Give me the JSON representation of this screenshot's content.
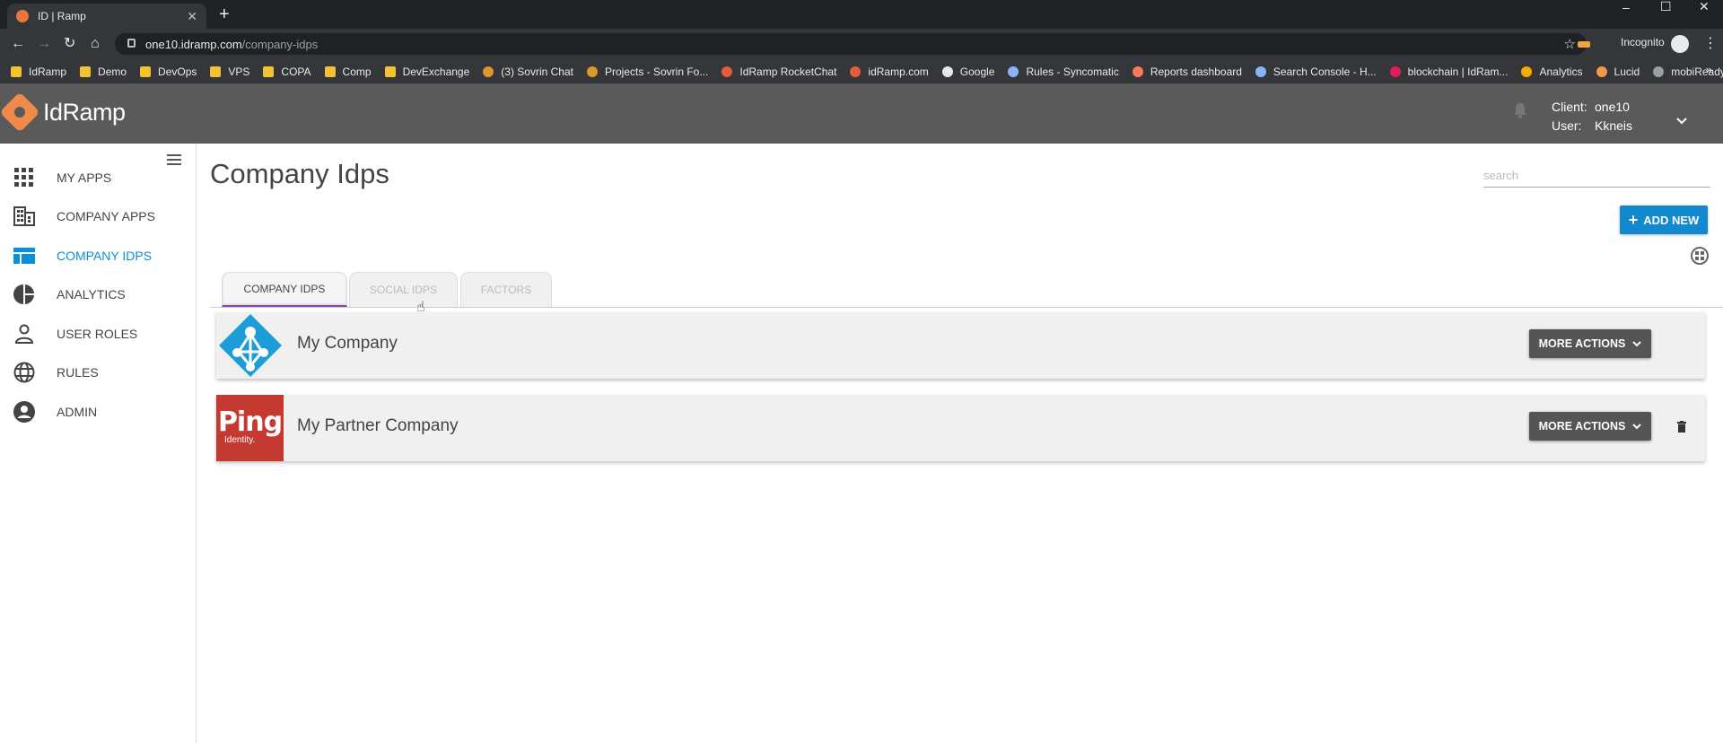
{
  "browser": {
    "tab_title": "ID | Ramp",
    "url_host": "one10.idramp.com",
    "url_path": "/company-idps",
    "incognito_label": "Incognito",
    "bookmarks": [
      {
        "label": "IdRamp",
        "icon": "folder-icon"
      },
      {
        "label": "Demo",
        "icon": "folder-icon"
      },
      {
        "label": "DevOps",
        "icon": "folder-icon"
      },
      {
        "label": "VPS",
        "icon": "folder-icon"
      },
      {
        "label": "COPA",
        "icon": "folder-icon"
      },
      {
        "label": "Comp",
        "icon": "folder-icon"
      },
      {
        "label": "DevExchange",
        "icon": "folder-icon"
      },
      {
        "label": "(3) Sovrin Chat",
        "icon": "sovrin-icon"
      },
      {
        "label": "Projects - Sovrin Fo...",
        "icon": "sovrin-icon"
      },
      {
        "label": "IdRamp RocketChat",
        "icon": "idramp-icon"
      },
      {
        "label": "idRamp.com",
        "icon": "idramp-icon"
      },
      {
        "label": "Google",
        "icon": "google-icon"
      },
      {
        "label": "Rules - Syncomatic",
        "icon": "doc-icon"
      },
      {
        "label": "Reports dashboard",
        "icon": "hubspot-icon"
      },
      {
        "label": "Search Console - H...",
        "icon": "search-console-icon"
      },
      {
        "label": "blockchain | IdRam...",
        "icon": "slack-icon"
      },
      {
        "label": "Analytics",
        "icon": "analytics-icon"
      },
      {
        "label": "Lucid",
        "icon": "lucid-icon"
      },
      {
        "label": "mobiReady",
        "icon": "mobiready-icon"
      }
    ],
    "bookmarks_more": "»"
  },
  "header": {
    "logo_text": "IdRamp",
    "client_label": "Client:",
    "client_value": "one10",
    "user_label": "User:",
    "user_value": "Kkneis"
  },
  "sidebar": {
    "items": [
      {
        "label": "MY APPS",
        "icon": "grid-icon",
        "active": false
      },
      {
        "label": "COMPANY APPS",
        "icon": "building-icon",
        "active": false
      },
      {
        "label": "COMPANY IDPS",
        "icon": "dashboard-icon",
        "active": true
      },
      {
        "label": "ANALYTICS",
        "icon": "pie-chart-icon",
        "active": false
      },
      {
        "label": "USER ROLES",
        "icon": "person-icon",
        "active": false
      },
      {
        "label": "RULES",
        "icon": "globe-icon",
        "active": false
      },
      {
        "label": "ADMIN",
        "icon": "account-circle-icon",
        "active": false
      }
    ]
  },
  "main": {
    "title": "Company Idps",
    "search_placeholder": "search",
    "add_new_label": "ADD NEW",
    "tabs": [
      {
        "label": "COMPANY IDPs",
        "active": true
      },
      {
        "label": "SOCIAL IDPs",
        "active": false
      },
      {
        "label": "FACTORS",
        "active": false
      }
    ],
    "idps": [
      {
        "name": "My Company",
        "logo": "azure-ad-icon",
        "action_label": "MORE ACTIONS",
        "deletable": false
      },
      {
        "name": "My Partner Company",
        "logo": "ping-identity-icon",
        "logo_text": "Ping",
        "logo_subtext": "Identity.",
        "action_label": "MORE ACTIONS",
        "deletable": true
      }
    ]
  },
  "colors": {
    "accent": "#0a8fd8",
    "add_button": "#1289cf",
    "header_bg": "#5a5a5a",
    "ping_red": "#c43a31",
    "azure_blue": "#1e9cd7",
    "tab_underline": "#8e44ad"
  }
}
